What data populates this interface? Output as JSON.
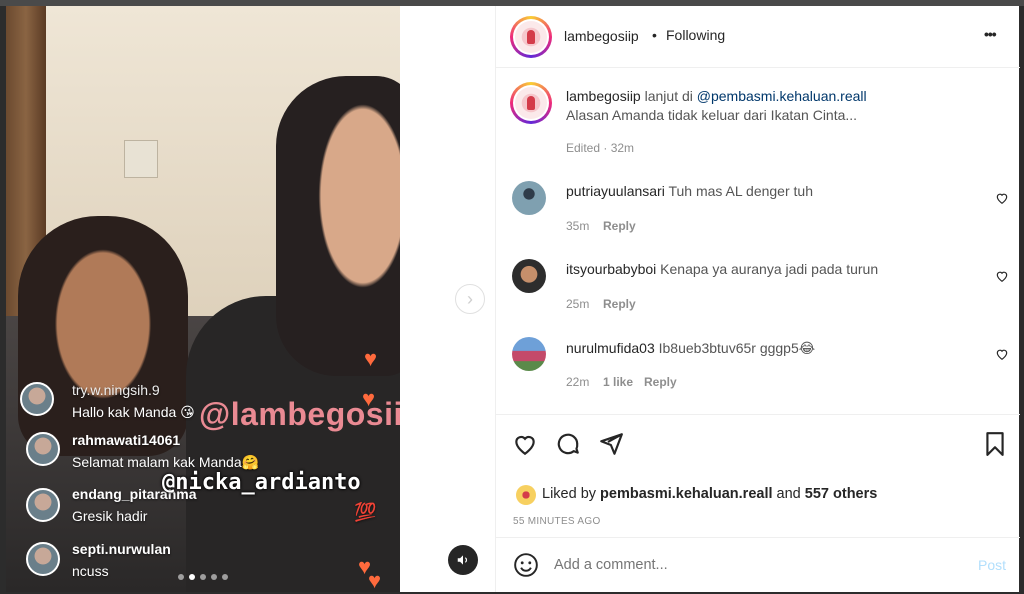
{
  "media": {
    "live_comments": [
      {
        "user": "try.w.ningsih.9",
        "text": "Hallo kak Manda 😘"
      },
      {
        "user": "rahmawati14061",
        "text": "Selamat malam kak Manda🤗"
      },
      {
        "user": "endang_pitarahma",
        "text": "Gresik hadir"
      },
      {
        "user": "septi.nurwulan",
        "text": "ncuss"
      }
    ],
    "watermark_main": "@lambegosiip",
    "watermark_second": "@nicka_ardianto",
    "hundred_emoji": "💯",
    "heart_glyph": "♥",
    "next_glyph": "›",
    "carousel_dots": 5,
    "active_dot": 1
  },
  "header": {
    "username": "lambegosiip",
    "separator": "•",
    "follow_status": "Following",
    "more": "•••"
  },
  "caption": {
    "username": "lambegosiip",
    "lead": "lanjut di",
    "mention": "@pembasmi.kehaluan.reall",
    "line2": "Alasan Amanda tidak keluar dari Ikatan Cinta...",
    "meta": "Edited · 32m"
  },
  "comments": [
    {
      "user": "putriayuulansari",
      "text": "Tuh mas AL denger tuh",
      "time": "35m",
      "likes": "",
      "reply": "Reply"
    },
    {
      "user": "itsyourbabyboi",
      "text": "Kenapa ya auranya jadi pada turun",
      "time": "25m",
      "likes": "",
      "reply": "Reply"
    },
    {
      "user": "nurulmufida03",
      "text": "Ib8ueb3btuv65r gggp5😂",
      "time": "22m",
      "likes": "1 like",
      "reply": "Reply"
    }
  ],
  "likes": {
    "prefix": "Liked by",
    "by": "pembasmi.kehaluan.reall",
    "and": "and",
    "others": "557 others",
    "time": "55 MINUTES AGO"
  },
  "comment_box": {
    "placeholder": "Add a comment...",
    "post": "Post"
  },
  "colors": {
    "link": "#00376b",
    "post_disabled": "#b2dffc",
    "heart_orange": "#ff6a3d"
  }
}
